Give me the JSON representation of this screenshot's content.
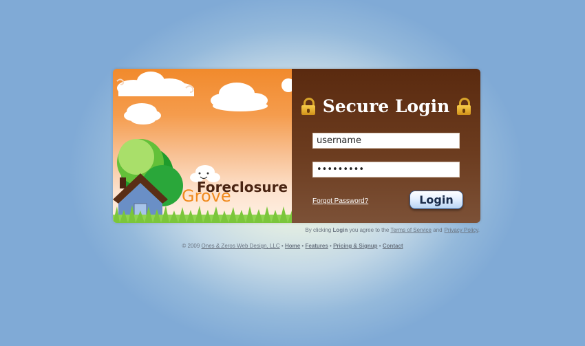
{
  "brand": {
    "logo_line1": "Foreclosure",
    "logo_line2": "Grove"
  },
  "login": {
    "title": "Secure Login",
    "username_value": "username",
    "password_value": "passwords",
    "forgot_label": "Forgot Password?",
    "button_label": "Login"
  },
  "terms": {
    "prefix": "By clicking",
    "bold": "Login",
    "middle": "you agree to the",
    "tos": "Terms of Service",
    "and": "and",
    "privacy": "Privacy Policy",
    "end": "."
  },
  "footer": {
    "copyright": "© 2009",
    "company": "Ones & Zeros Web Design, LLC",
    "sep": "•",
    "links": [
      "Home",
      "Features",
      "Pricing & Signup",
      "Contact"
    ]
  },
  "colors": {
    "accent_orange": "#f18a2c",
    "panel_brown": "#5a2a0f",
    "background_blue": "#80aad6"
  }
}
